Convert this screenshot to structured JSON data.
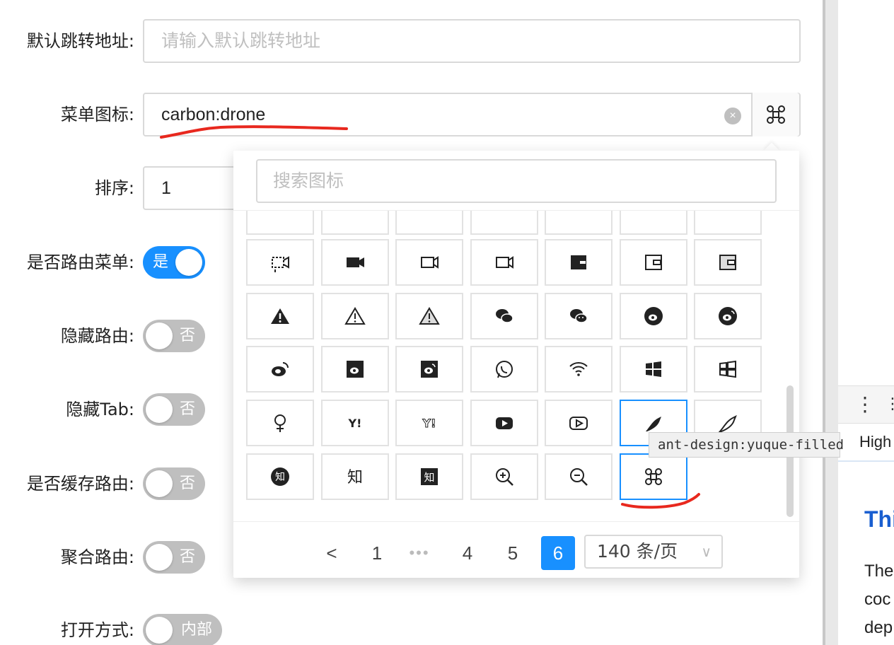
{
  "form": {
    "redirect": {
      "label": "默认跳转地址:",
      "placeholder": "请输入默认跳转地址"
    },
    "menu_icon": {
      "label": "菜单图标:",
      "value": "carbon:drone",
      "icon": "drone-icon"
    },
    "sort": {
      "label": "排序:",
      "value": "1"
    },
    "is_route_menu": {
      "label": "是否路由菜单:",
      "state": "是",
      "on": true
    },
    "hide_route": {
      "label": "隐藏路由:",
      "state": "否",
      "on": false
    },
    "hide_tab": {
      "label": "隐藏Tab:",
      "state": "否",
      "on": false
    },
    "cache_route": {
      "label": "是否缓存路由:",
      "state": "否",
      "on": false
    },
    "aggregate_route": {
      "label": "聚合路由:",
      "state": "否",
      "on": false
    },
    "open_mode": {
      "label": "打开方式:",
      "state": "内部",
      "on": false
    }
  },
  "icon_picker": {
    "search_placeholder": "搜索图标",
    "rows": [
      [
        "partial-icon",
        "partial-icon",
        "partial-icon",
        "partial-icon",
        "partial-icon",
        "partial-icon",
        "partial-icon"
      ],
      [
        "video-add-icon",
        "video-filled-icon",
        "video-outline-icon",
        "video-outline-icon",
        "wallet-filled-icon",
        "wallet-outline-icon",
        "wallet-twotone-icon"
      ],
      [
        "warning-filled-icon",
        "warning-outline-icon",
        "warning-twotone-icon",
        "wechat-filled-icon",
        "wechat-outline-icon",
        "weibo-circle-filled-icon",
        "weibo-circle-outline-icon"
      ],
      [
        "weibo-icon",
        "weibo-square-filled-icon",
        "weibo-square-outline-icon",
        "whatsapp-icon",
        "wifi-icon",
        "windows-filled-icon",
        "windows-outline-icon"
      ],
      [
        "woman-icon",
        "yahoo-filled-icon",
        "yahoo-outline-icon",
        "youtube-filled-icon",
        "youtube-outline-icon",
        "yuque-filled-icon",
        "yuque-outline-icon"
      ],
      [
        "zhihu-circle-icon",
        "zhihu-icon",
        "zhihu-square-icon",
        "zoom-in-icon",
        "zoom-out-icon",
        "drone-icon"
      ]
    ],
    "text_glyphs": {
      "zhihu": "知",
      "yahoo": "Y!"
    },
    "tooltip": "ant-design:yuque-filled",
    "pagination": {
      "prev": "<",
      "pages": [
        "1",
        "•••",
        "4",
        "5",
        "6"
      ],
      "current": "6",
      "page_size": "140 条/页"
    }
  },
  "right_panel": {
    "menu_dots": "⋮",
    "tab_label": "High",
    "heading": "Thi",
    "body_lines": [
      "The",
      "coc",
      "dep"
    ]
  },
  "colors": {
    "primary": "#1890ff",
    "annotation": "#e8281e",
    "border": "#d9d9d9"
  }
}
